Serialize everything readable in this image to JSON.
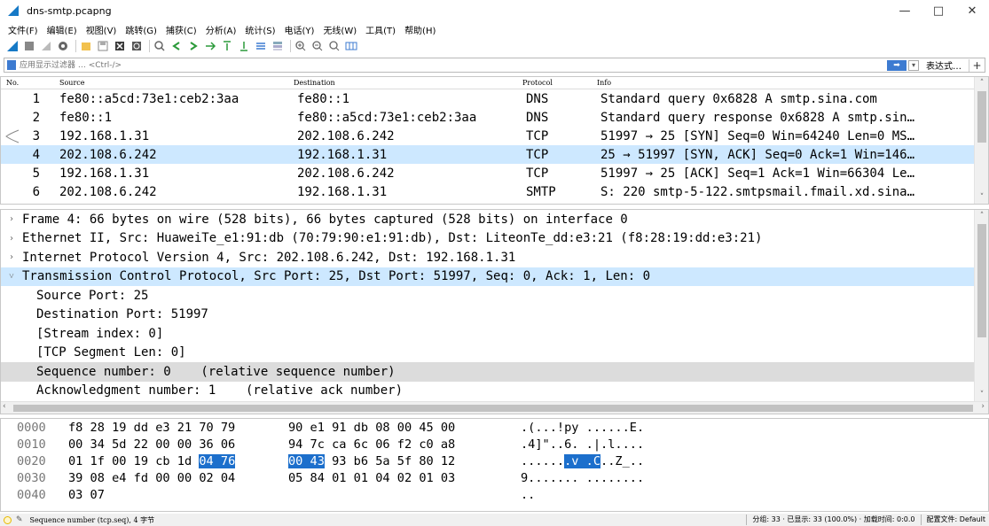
{
  "window": {
    "title": "dns-smtp.pcapng",
    "minimize": "—",
    "maximize": "□",
    "close": "✕"
  },
  "menu": [
    "文件(F)",
    "编辑(E)",
    "视图(V)",
    "跳转(G)",
    "捕获(C)",
    "分析(A)",
    "统计(S)",
    "电话(Y)",
    "无线(W)",
    "工具(T)",
    "帮助(H)"
  ],
  "filter": {
    "placeholder": "应用显示过滤器 … <Ctrl-/>",
    "expression_label": "表达式…",
    "add": "+"
  },
  "packet_list": {
    "columns": {
      "no": "No.",
      "source": "Source",
      "destination": "Destination",
      "protocol": "Protocol",
      "info": "Info"
    },
    "rows": [
      {
        "no": "1",
        "source": "fe80::a5cd:73e1:ceb2:3aa",
        "destination": "fe80::1",
        "protocol": "DNS",
        "info": "Standard query 0x6828 A smtp.sina.com"
      },
      {
        "no": "2",
        "source": "fe80::1",
        "destination": "fe80::a5cd:73e1:ceb2:3aa",
        "protocol": "DNS",
        "info": "Standard query response 0x6828 A smtp.sin…"
      },
      {
        "no": "3",
        "source": "192.168.1.31",
        "destination": "202.108.6.242",
        "protocol": "TCP",
        "info": "51997 → 25 [SYN] Seq=0 Win=64240 Len=0 MS…"
      },
      {
        "no": "4",
        "source": "202.108.6.242",
        "destination": "192.168.1.31",
        "protocol": "TCP",
        "info": "25 → 51997 [SYN, ACK] Seq=0 Ack=1 Win=146…"
      },
      {
        "no": "5",
        "source": "192.168.1.31",
        "destination": "202.108.6.242",
        "protocol": "TCP",
        "info": "51997 → 25 [ACK] Seq=1 Ack=1 Win=66304 Le…"
      },
      {
        "no": "6",
        "source": "202.108.6.242",
        "destination": "192.168.1.31",
        "protocol": "SMTP",
        "info": "S: 220 smtp-5-122.smtpsmail.fmail.xd.sina…"
      }
    ],
    "selected_row": 3
  },
  "details": {
    "lines": [
      {
        "text": "Frame 4: 66 bytes on wire (528 bits), 66 bytes captured (528 bits) on interface 0",
        "expander": "›"
      },
      {
        "text": "Ethernet II, Src: HuaweiTe_e1:91:db (70:79:90:e1:91:db), Dst: LiteonTe_dd:e3:21 (f8:28:19:dd:e3:21)",
        "expander": "›"
      },
      {
        "text": "Internet Protocol Version 4, Src: 202.108.6.242, Dst: 192.168.1.31",
        "expander": "›"
      },
      {
        "text": "Transmission Control Protocol, Src Port: 25, Dst Port: 51997, Seq: 0, Ack: 1, Len: 0",
        "expander": "˅"
      },
      {
        "text": "Source Port: 25"
      },
      {
        "text": "Destination Port: 51997"
      },
      {
        "text": "[Stream index: 0]"
      },
      {
        "text": "[TCP Segment Len: 0]"
      },
      {
        "text": "Sequence number: 0    (relative sequence number)"
      },
      {
        "text": "Acknowledgment number: 1    (relative ack number)"
      }
    ]
  },
  "bytes": {
    "rows": [
      {
        "offset": "0000",
        "hex1": "f8 28 19 dd e3 21 70 79",
        "hex2": "90 e1 91 db 08 00 45 00",
        "ascii": ".(...!py ......E."
      },
      {
        "offset": "0010",
        "hex1": "00 34 5d 22 00 00 36 06",
        "hex2": "94 7c ca 6c 06 f2 c0 a8",
        "ascii": ".4]\"..6. .|.l...."
      },
      {
        "offset": "0020",
        "hex1a": "01 1f 00 19 cb 1d ",
        "hex1b": "04 76",
        "hex2a": "00 43",
        "hex2b": " 93 b6 5a 5f 80 12",
        "ascii_a": "......",
        "ascii_b": ".v .C",
        "ascii_c": "..Z_.."
      },
      {
        "offset": "0030",
        "hex1": "39 08 e4 fd 00 00 02 04",
        "hex2": "05 84 01 01 04 02 01 03",
        "ascii": "9....... ........"
      },
      {
        "offset": "0040",
        "hex1": "03 07",
        "hex2": "",
        "ascii": ".."
      }
    ]
  },
  "status": {
    "field": "Sequence number (tcp.seq), 4 字节",
    "packets": "分组: 33 · 已显示: 33 (100.0%) · 加载时间: 0:0.0",
    "profile": "配置文件: Default"
  },
  "colors": {
    "selection": "#cde8ff",
    "field_highlight": "#dcdcdc",
    "byte_highlight": "#1c6fcc",
    "accent": "#3d7bd1"
  }
}
